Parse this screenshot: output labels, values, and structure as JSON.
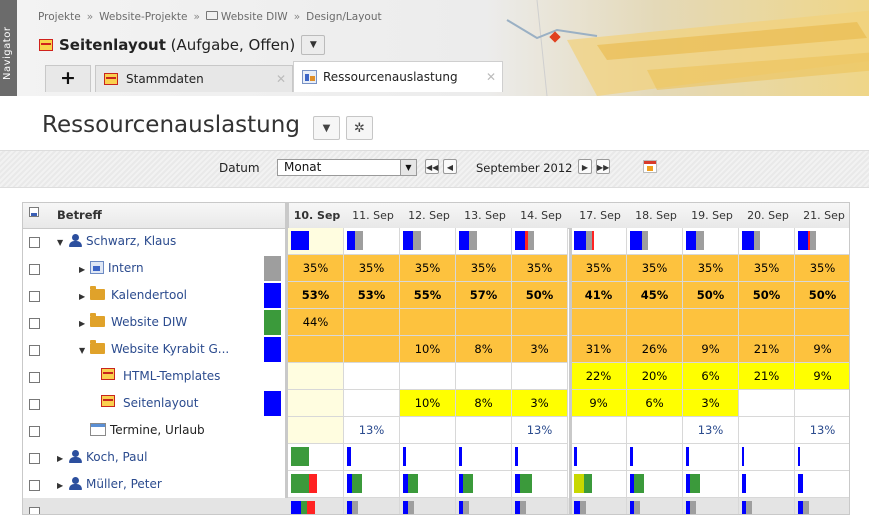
{
  "navigator": {
    "label": "Navigator"
  },
  "breadcrumb": [
    "Projekte",
    "Website-Projekte",
    "Website DIW",
    "Design/Layout"
  ],
  "breadcrumb_sep": "»",
  "task": {
    "title": "Seitenlayout",
    "subtitle": "(Aufgabe, Offen)"
  },
  "tabs": {
    "add": "+",
    "stammdaten": "Stammdaten",
    "ressourcen": "Ressourcenauslastung",
    "close": "✕"
  },
  "page_title": "Ressourcenauslastung",
  "toolbar": {
    "datum_label": "Datum",
    "period_value": "Monat",
    "month_label": "September 2012"
  },
  "grid": {
    "betreff_header": "Betreff",
    "days": [
      "10. Sep",
      "11. Sep",
      "12. Sep",
      "13. Sep",
      "14. Sep",
      "17. Sep",
      "18. Sep",
      "19. Sep",
      "20. Sep",
      "21. Sep"
    ],
    "rows": [
      {
        "label": "Schwarz, Klaus",
        "icon": "person-icon",
        "indent": 0,
        "expander": "▼",
        "link": true,
        "cells": [
          "",
          "",
          "",
          "",
          "",
          "",
          "",
          "",
          "",
          ""
        ]
      },
      {
        "label": "Intern",
        "icon": "project-icon",
        "indent": 1,
        "expander": "▶",
        "link": true,
        "cells": [
          "35%",
          "35%",
          "35%",
          "35%",
          "35%",
          "35%",
          "35%",
          "35%",
          "35%",
          "35%"
        ]
      },
      {
        "label": "Kalendertool",
        "icon": "folder-icon",
        "indent": 1,
        "expander": "▶",
        "link": true,
        "cells": [
          "53%",
          "53%",
          "55%",
          "57%",
          "50%",
          "41%",
          "45%",
          "50%",
          "50%",
          "50%"
        ]
      },
      {
        "label": "Website DIW",
        "icon": "folder-icon",
        "indent": 1,
        "expander": "▶",
        "link": true,
        "cells": [
          "44%",
          "",
          "",
          "",
          "",
          "",
          "",
          "",
          "",
          ""
        ]
      },
      {
        "label": "Website Kyrabit G...",
        "icon": "folder-icon",
        "indent": 1,
        "expander": "▼",
        "link": true,
        "cells": [
          "",
          "",
          "10%",
          "8%",
          "3%",
          "31%",
          "26%",
          "9%",
          "21%",
          "9%"
        ]
      },
      {
        "label": "HTML-Templates",
        "icon": "task-icon",
        "indent": 2,
        "expander": "",
        "link": true,
        "cells": [
          "",
          "",
          "",
          "",
          "",
          "22%",
          "20%",
          "6%",
          "21%",
          "9%"
        ]
      },
      {
        "label": "Seitenlayout",
        "icon": "task-icon",
        "indent": 2,
        "expander": "",
        "link": true,
        "cells": [
          "",
          "",
          "10%",
          "8%",
          "3%",
          "9%",
          "6%",
          "3%",
          "",
          ""
        ]
      },
      {
        "label": "Termine, Urlaub",
        "icon": "calendar-icon",
        "indent": 1,
        "expander": "",
        "link": false,
        "cells": [
          "",
          "13%",
          "",
          "",
          "13%",
          "",
          "",
          "13%",
          "",
          "13%"
        ]
      },
      {
        "label": "Koch, Paul",
        "icon": "person-icon",
        "indent": 0,
        "expander": "▶",
        "link": true,
        "cells": [
          "",
          "",
          "",
          "",
          "",
          "",
          "",
          "",
          "",
          ""
        ]
      },
      {
        "label": "Müller, Peter",
        "icon": "person-icon",
        "indent": 0,
        "expander": "▶",
        "link": true,
        "cells": [
          "",
          "",
          "",
          "",
          "",
          "",
          "",
          "",
          "",
          ""
        ]
      },
      {
        "label": "",
        "icon": "",
        "indent": 0,
        "expander": "",
        "link": false,
        "cells": [
          "",
          "",
          "",
          "",
          "",
          "",
          "",
          "",
          "",
          ""
        ]
      }
    ]
  },
  "colors": {
    "orange": "#fdc23e",
    "yellow": "#ffff00",
    "today_bg": "#fffde0",
    "blue": "#0000ff",
    "green": "#3b9a3b",
    "red": "#ff2222",
    "gray": "#9e9e9e",
    "link": "#2b4b8e"
  }
}
